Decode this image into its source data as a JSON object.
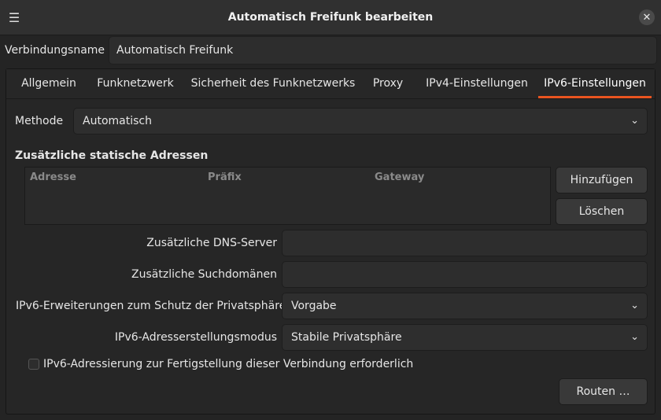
{
  "titlebar": {
    "menu_icon": "☰",
    "title": "Automatisch Freifunk bearbeiten",
    "close_icon": "✕"
  },
  "connection": {
    "label": "Verbindungsname",
    "value": "Automatisch Freifunk"
  },
  "tabs": [
    {
      "label": "Allgemein",
      "active": false
    },
    {
      "label": "Funknetzwerk",
      "active": false
    },
    {
      "label": "Sicherheit des Funknetzwerks",
      "active": false
    },
    {
      "label": "Proxy",
      "active": false
    },
    {
      "label": "IPv4-Einstellungen",
      "active": false
    },
    {
      "label": "IPv6-Einstellungen",
      "active": true
    }
  ],
  "ipv6": {
    "method_label": "Methode",
    "method_value": "Automatisch",
    "static_title": "Zusätzliche statische Adressen",
    "columns": [
      "Adresse",
      "Präfix",
      "Gateway"
    ],
    "add_button": "Hinzufügen",
    "delete_button": "Löschen",
    "dns_label": "Zusätzliche DNS-Server",
    "dns_value": "",
    "search_label": "Zusätzliche Suchdomänen",
    "search_value": "",
    "privacy_label": "IPv6-Erweiterungen zum Schutz der Privatsphäre",
    "privacy_value": "Vorgabe",
    "addrgen_label": "IPv6-Adresserstellungsmodus",
    "addrgen_value": "Stabile Privatsphäre",
    "required_label": "IPv6-Adressierung zur Fertigstellung dieser Verbindung erforderlich",
    "required_checked": false,
    "routes_button": "Routen …"
  },
  "colors": {
    "accent": "#e95420",
    "background": "#242424"
  },
  "icons": {
    "dropdown": "⌄"
  }
}
